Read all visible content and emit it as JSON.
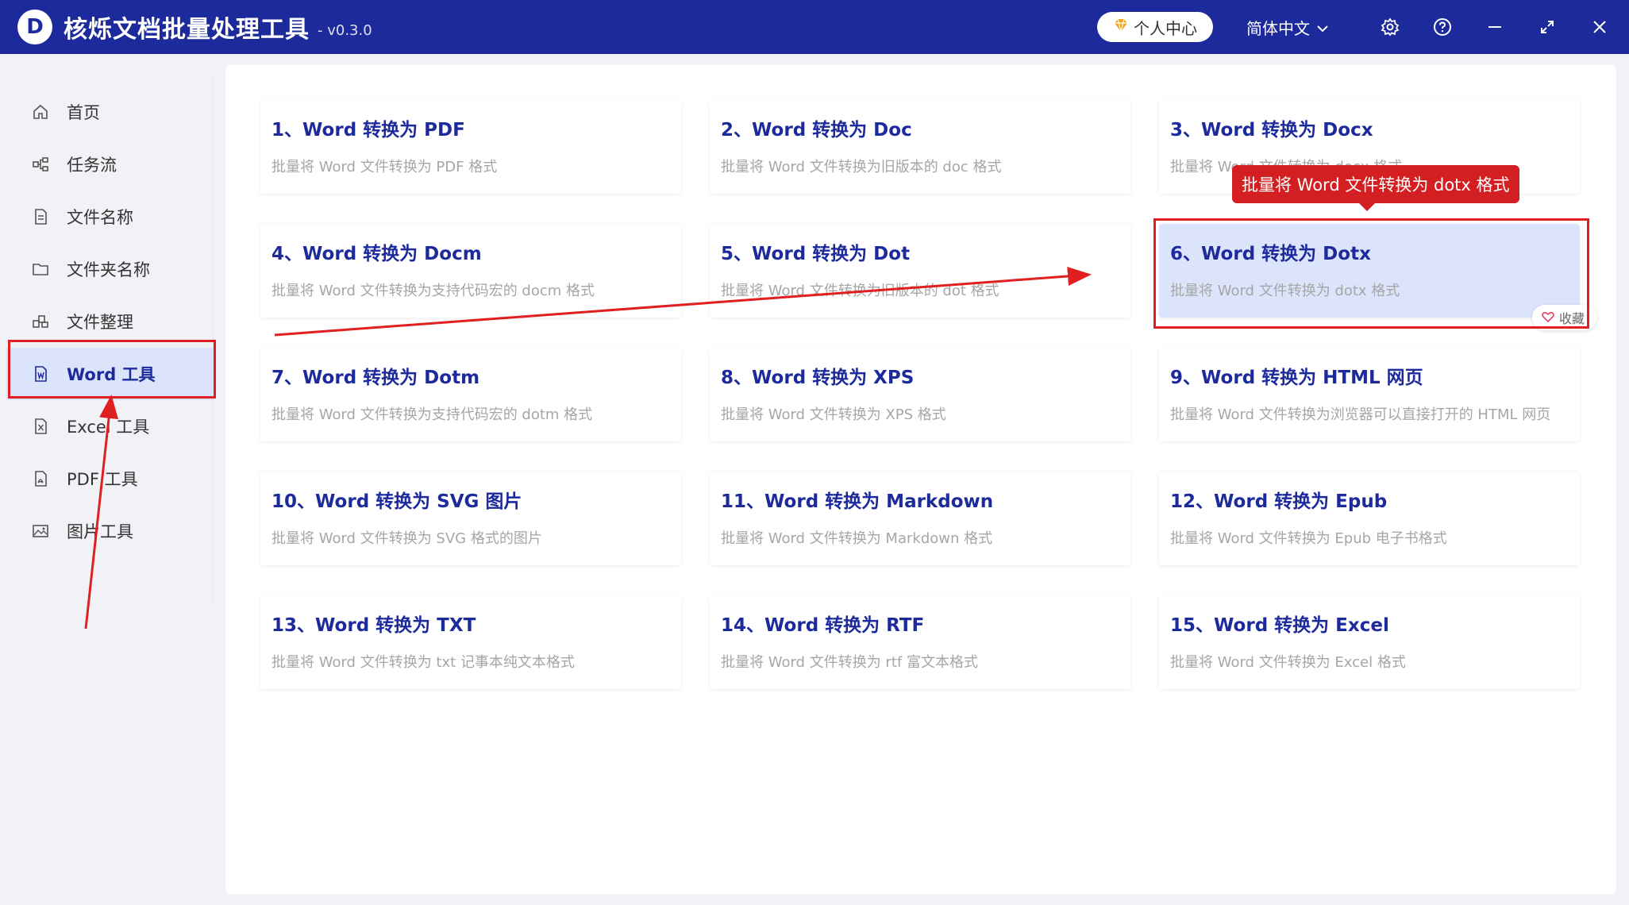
{
  "app": {
    "title": "核烁文档批量处理工具",
    "version": "- v0.3.0",
    "logo_letter": "D"
  },
  "titlebar": {
    "user_center": "个人中心",
    "language": "简体中文"
  },
  "sidebar": {
    "items": [
      {
        "label": "首页",
        "icon": "home-icon"
      },
      {
        "label": "任务流",
        "icon": "workflow-icon"
      },
      {
        "label": "文件名称",
        "icon": "file-icon"
      },
      {
        "label": "文件夹名称",
        "icon": "folder-icon"
      },
      {
        "label": "文件整理",
        "icon": "organize-icon"
      },
      {
        "label": "Word 工具",
        "icon": "word-icon"
      },
      {
        "label": "Excel 工具",
        "icon": "excel-icon"
      },
      {
        "label": "PDF 工具",
        "icon": "pdf-icon"
      },
      {
        "label": "图片工具",
        "icon": "image-icon"
      }
    ],
    "active_index": 5
  },
  "cards": [
    {
      "title": "1、Word 转换为 PDF",
      "desc": "批量将 Word 文件转换为 PDF 格式"
    },
    {
      "title": "2、Word 转换为 Doc",
      "desc": "批量将 Word 文件转换为旧版本的 doc 格式"
    },
    {
      "title": "3、Word 转换为 Docx",
      "desc": "批量将 Word 文件转换为 docx 格式"
    },
    {
      "title": "4、Word 转换为 Docm",
      "desc": "批量将 Word 文件转换为支持代码宏的 docm 格式"
    },
    {
      "title": "5、Word 转换为 Dot",
      "desc": "批量将 Word 文件转换为旧版本的 dot 格式"
    },
    {
      "title": "6、Word 转换为 Dotx",
      "desc": "批量将 Word 文件转换为 dotx 格式"
    },
    {
      "title": "7、Word 转换为 Dotm",
      "desc": "批量将 Word 文件转换为支持代码宏的 dotm 格式"
    },
    {
      "title": "8、Word 转换为 XPS",
      "desc": "批量将 Word 文件转换为 XPS 格式"
    },
    {
      "title": "9、Word 转换为 HTML 网页",
      "desc": "批量将 Word 文件转换为浏览器可以直接打开的 HTML 网页"
    },
    {
      "title": "10、Word 转换为 SVG 图片",
      "desc": "批量将 Word 文件转换为 SVG 格式的图片"
    },
    {
      "title": "11、Word 转换为 Markdown",
      "desc": "批量将 Word 文件转换为 Markdown 格式"
    },
    {
      "title": "12、Word 转换为 Epub",
      "desc": "批量将 Word 文件转换为 Epub 电子书格式"
    },
    {
      "title": "13、Word 转换为 TXT",
      "desc": "批量将 Word 文件转换为 txt 记事本纯文本格式"
    },
    {
      "title": "14、Word 转换为 RTF",
      "desc": "批量将 Word 文件转换为 rtf 富文本格式"
    },
    {
      "title": "15、Word 转换为 Excel",
      "desc": "批量将 Word 文件转换为 Excel 格式"
    }
  ],
  "hovered_card_index": 5,
  "favorite_label": "收藏",
  "tooltip": "批量将 Word 文件转换为 dotx 格式",
  "colors": {
    "titlebar": "#1d2a9c",
    "accent": "#1d2a9c",
    "active_bg": "#dbe4fb",
    "annotation_red": "#e02020"
  }
}
